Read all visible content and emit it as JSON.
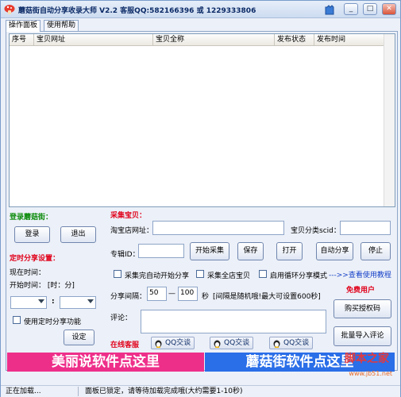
{
  "window": {
    "title": "蘑菇街自动分享收录大师 V2.2  客服QQ:582166396 或 1229333806"
  },
  "tabs": [
    {
      "label": "操作面板"
    },
    {
      "label": "使用帮助"
    }
  ],
  "table": {
    "columns": [
      "序号",
      "宝贝网址",
      "宝贝全称",
      "发布状态",
      "发布时间"
    ]
  },
  "login": {
    "heading": "登录蘑菇街：",
    "login_button": "登录",
    "logout_button": "退出"
  },
  "schedule": {
    "heading": "定时分享设置：",
    "current_time_label": "现在时间：",
    "start_time_label": "开始时间：  [时：分]",
    "colon": ":",
    "enable_label": "使用定时分享功能",
    "set_button": "设定"
  },
  "collect": {
    "heading": "采集宝贝：",
    "shop_url_label": "淘宝店网址：",
    "category_label": "宝贝分类scid：",
    "topic_label": "专辑ID：",
    "start_collect_button": "开始采集",
    "save_button": "保存",
    "open_button": "打开",
    "auto_share_button": "自动分享",
    "stop_button": "停止",
    "tutorial_link": "--->>查看使用教程",
    "auto_start_label": "采集完自动开始分享",
    "whole_shop_label": "采集全店宝贝",
    "loop_share_label": "启用循环分享模式",
    "interval_label": "分享间隔：",
    "interval_from": "50",
    "dash": "—",
    "interval_to": "100",
    "interval_unit": "秒",
    "interval_note": "[间隔是随机哦!最大可设置600秒]",
    "comment_label": "评论：",
    "free_user": "免费用户",
    "buy_license_button": "购买授权码",
    "batch_comment_button": "批量导入评论"
  },
  "support": {
    "heading": "在线客服",
    "qq_buttons": [
      "QQ交谈",
      "QQ交谈",
      "QQ交谈"
    ]
  },
  "banners": {
    "left": "美丽说软件点这里",
    "right": "蘑菇街软件点这里"
  },
  "watermark": {
    "text": "脚本之家",
    "url": "www.jb51.net"
  },
  "status": {
    "left": "正在加载...",
    "right": "面板已锁定，请等待加载完成哦(大约需要1-10秒)"
  },
  "colors": {
    "banner_left": "#ee2f8a",
    "banner_right": "#2a6ee8",
    "heading_green": "#0a8a0a",
    "heading_red": "#e0001a"
  }
}
